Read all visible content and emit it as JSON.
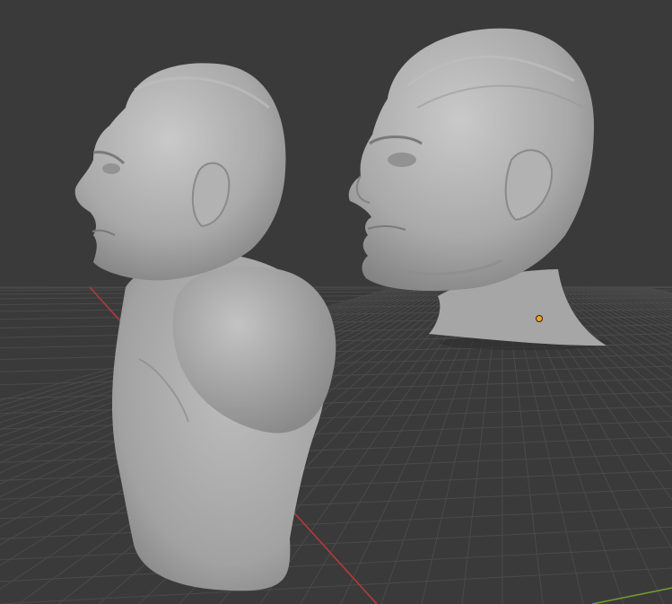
{
  "viewport": {
    "background_color": "#3a3a3a",
    "grid_color": "#4a4a4a",
    "x_axis_color": "#b5393a",
    "y_axis_color": "#6f9a2e",
    "mesh_color": "#a9a9a9",
    "origin_color": "#f0a22a"
  },
  "objects": [
    {
      "id": "bust",
      "icon": "sculpt-mesh-icon",
      "selected": false
    },
    {
      "id": "head",
      "icon": "sculpt-mesh-icon",
      "selected": true
    }
  ]
}
